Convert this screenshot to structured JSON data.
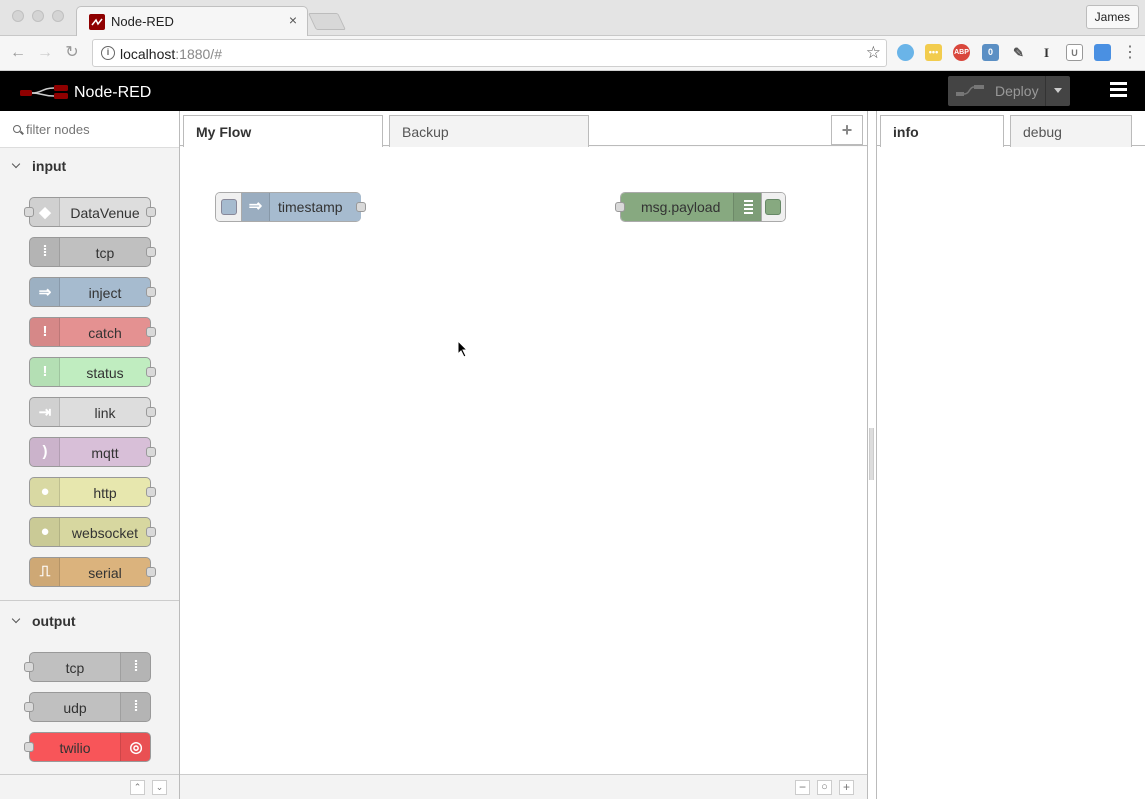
{
  "browser": {
    "tab_title": "Node-RED",
    "tab_close": "×",
    "profile_name": "James",
    "url_host": "localhost",
    "url_rest": ":1880/#",
    "extensions": [
      {
        "name": "vimeo-icon",
        "text": "",
        "color": "#6ab4e8"
      },
      {
        "name": "notes-icon",
        "text": "•••",
        "color": "#f2cc4e"
      },
      {
        "name": "adblock-icon",
        "text": "ABP",
        "color": "#d9473c"
      },
      {
        "name": "password-icon",
        "text": "0",
        "color": "#5b8fc4"
      },
      {
        "name": "pin-icon",
        "text": "✎",
        "color": "#555555"
      },
      {
        "name": "text-cursor-icon",
        "text": "I",
        "color": "#555555"
      },
      {
        "name": "u-box-icon",
        "text": "U",
        "color": "#777777"
      },
      {
        "name": "camera-icon",
        "text": "",
        "color": "#4a90e2"
      }
    ],
    "more_menu": "⋮"
  },
  "header": {
    "title": "Node-RED",
    "deploy_label": "Deploy"
  },
  "palette": {
    "filter_placeholder": "filter nodes",
    "categories": [
      {
        "label": "input",
        "nodes": [
          {
            "label": "DataVenue",
            "color": "#dddddd",
            "icon": "datavenue-icon",
            "glyph": "◆"
          },
          {
            "label": "tcp",
            "color": "#c0c0c0",
            "icon": "bridge-icon",
            "glyph": "⁞"
          },
          {
            "label": "inject",
            "color": "#a6bbcf",
            "icon": "inject-arrow-icon",
            "glyph": "⇒"
          },
          {
            "label": "catch",
            "color": "#e49191",
            "icon": "alert-icon",
            "glyph": "!"
          },
          {
            "label": "status",
            "color": "#c0edc0",
            "icon": "alert-icon",
            "glyph": "!"
          },
          {
            "label": "link",
            "color": "#dddddd",
            "icon": "link-in-icon",
            "glyph": "⇥"
          },
          {
            "label": "mqtt",
            "color": "#d8bfd8",
            "icon": "radio-waves-icon",
            "glyph": ")"
          },
          {
            "label": "http",
            "color": "#e7e7ae",
            "icon": "globe-icon",
            "glyph": "●"
          },
          {
            "label": "websocket",
            "color": "#d7d7a0",
            "icon": "globe-icon",
            "glyph": "●"
          },
          {
            "label": "serial",
            "color": "#dbb37d",
            "icon": "serial-wave-icon",
            "glyph": "⎍"
          }
        ]
      },
      {
        "label": "output",
        "nodes": [
          {
            "label": "tcp",
            "color": "#c0c0c0",
            "icon": "bridge-icon",
            "glyph": "⁞"
          },
          {
            "label": "udp",
            "color": "#c0c0c0",
            "icon": "bridge-icon",
            "glyph": "⁞"
          },
          {
            "label": "twilio",
            "color": "#f85559",
            "icon": "twilio-icon",
            "glyph": "◎"
          }
        ]
      }
    ]
  },
  "workspace": {
    "tabs": [
      {
        "label": "My Flow",
        "active": true
      },
      {
        "label": "Backup",
        "active": false
      }
    ],
    "add_tab": "+",
    "nodes": [
      {
        "label": "timestamp",
        "type": "inject",
        "color": "#a6bbcf"
      },
      {
        "label": "msg.payload",
        "type": "debug",
        "color": "#87a980"
      }
    ],
    "zoom_out": "−",
    "zoom_reset": "○",
    "zoom_in": "+"
  },
  "sidebar": {
    "tabs": [
      {
        "label": "info",
        "active": true
      },
      {
        "label": "debug",
        "active": false
      }
    ]
  },
  "palette_footer": {
    "collapse_all": "⌃",
    "expand_all": "⌄"
  }
}
